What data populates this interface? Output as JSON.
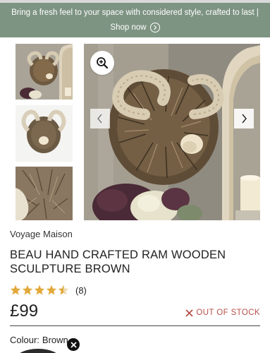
{
  "promo": {
    "message": "Bring a fresh feel to your space with considered style, crafted to last |",
    "cta": "Shop now"
  },
  "gallery": {
    "thumbnails": [
      "thumbnail-1",
      "thumbnail-2",
      "thumbnail-3"
    ],
    "main_image": "ram-sculpture-photo"
  },
  "product": {
    "brand": "Voyage Maison",
    "title": "BEAU HAND CRAFTED RAM WOODEN SCULPTURE BROWN",
    "rating": 4.5,
    "review_count": "(8)",
    "price": "£99",
    "stock_status": "OUT OF STOCK",
    "colour_label": "Colour:",
    "colour_value": "Brown"
  },
  "colors": {
    "promo_bg": "#7e9483",
    "stock": "#b7504a",
    "star": "#e2a93a"
  }
}
